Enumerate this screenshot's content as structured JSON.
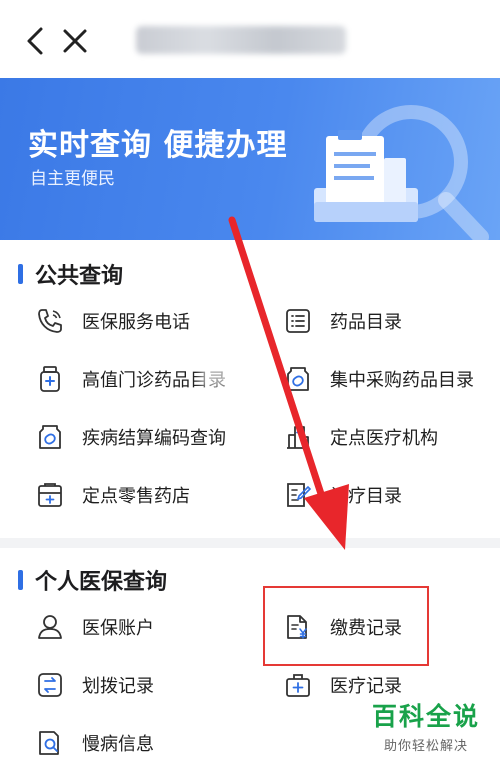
{
  "banner": {
    "title": "实时查询 便捷办理",
    "subtitle": "自主更便民",
    "accent": "#3b79e6"
  },
  "public_query": {
    "title": "公共查询",
    "items": [
      {
        "label": "医保服务电话",
        "icon": "phone-icon"
      },
      {
        "label": "药品目录",
        "icon": "list-icon"
      },
      {
        "label": "高值门诊药品目录",
        "icon": "medicine-bottle-icon"
      },
      {
        "label": "集中采购药品目录",
        "icon": "pill-bag-icon"
      },
      {
        "label": "疾病结算编码查询",
        "icon": "pill-code-icon"
      },
      {
        "label": "定点医疗机构",
        "icon": "hospital-icon"
      },
      {
        "label": "定点零售药店",
        "icon": "pharmacy-icon"
      },
      {
        "label": "诊疗目录",
        "icon": "treatment-list-icon"
      }
    ]
  },
  "personal_query": {
    "title": "个人医保查询",
    "items": [
      {
        "label": "医保账户",
        "icon": "user-icon"
      },
      {
        "label": "缴费记录",
        "icon": "payment-record-icon"
      },
      {
        "label": "划拨记录",
        "icon": "transfer-icon"
      },
      {
        "label": "医疗记录",
        "icon": "medical-kit-icon"
      },
      {
        "label": "慢病信息",
        "icon": "chronic-disease-icon"
      }
    ]
  },
  "watermark": {
    "main": "百科全说",
    "sub": "助你轻松解决"
  }
}
